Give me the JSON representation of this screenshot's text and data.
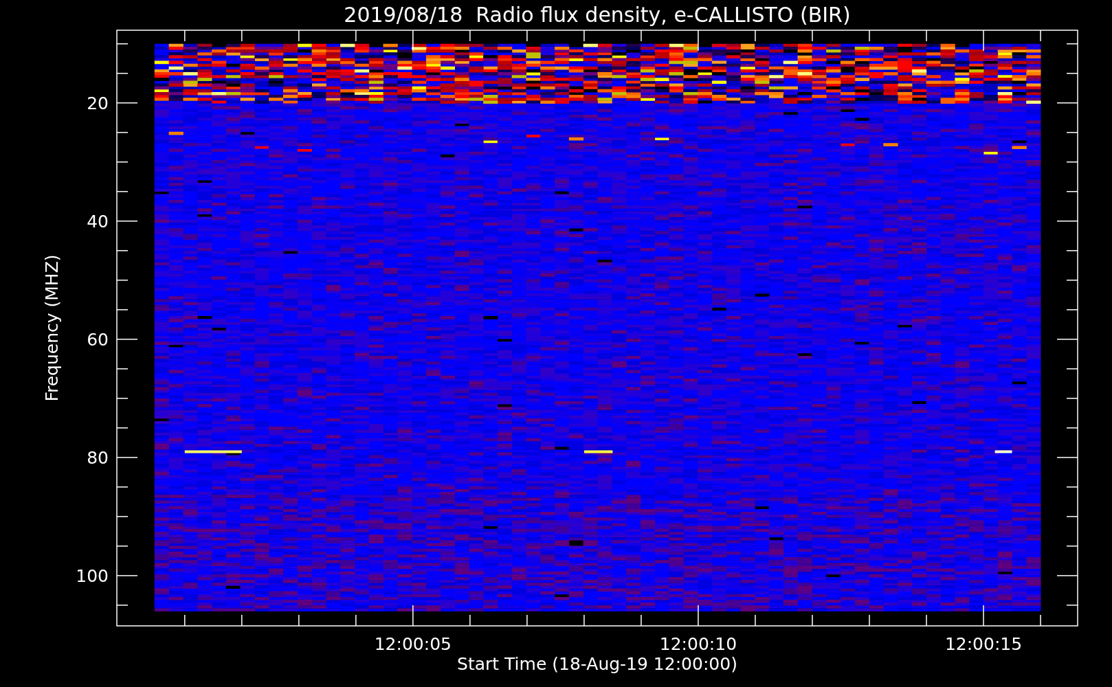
{
  "plot": {
    "title": "2019/08/18  Radio flux density, e-CALLISTO (BIR)",
    "ylabel": "Frequency (MHZ)",
    "xlabel": "Start Time (18-Aug-19 12:00:00)",
    "yticks": [
      "20",
      "40",
      "60",
      "80",
      "100"
    ],
    "xticks": [
      "12:00:05",
      "12:00:10",
      "12:00:15"
    ]
  }
}
